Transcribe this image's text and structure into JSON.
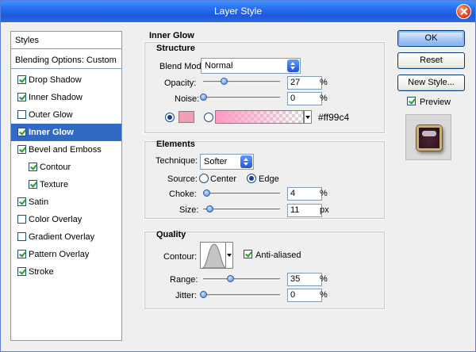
{
  "window": {
    "title": "Layer Style"
  },
  "styles_list": {
    "header": "Styles",
    "blending": "Blending Options: Custom",
    "items": [
      {
        "label": "Drop Shadow",
        "checked": true,
        "selected": false
      },
      {
        "label": "Inner Shadow",
        "checked": true,
        "selected": false
      },
      {
        "label": "Outer Glow",
        "checked": false,
        "selected": false
      },
      {
        "label": "Inner Glow",
        "checked": true,
        "selected": true
      },
      {
        "label": "Bevel and Emboss",
        "checked": true,
        "selected": false
      },
      {
        "label": "Contour",
        "checked": true,
        "selected": false
      },
      {
        "label": "Texture",
        "checked": true,
        "selected": false
      },
      {
        "label": "Satin",
        "checked": true,
        "selected": false
      },
      {
        "label": "Color Overlay",
        "checked": false,
        "selected": false
      },
      {
        "label": "Gradient Overlay",
        "checked": false,
        "selected": false
      },
      {
        "label": "Pattern Overlay",
        "checked": true,
        "selected": false
      },
      {
        "label": "Stroke",
        "checked": true,
        "selected": false
      }
    ]
  },
  "panel": {
    "title": "Inner Glow",
    "structure": {
      "title": "Structure",
      "blend_mode_label": "Blend Mode:",
      "blend_mode_value": "Normal",
      "opacity_label": "Opacity:",
      "opacity_value": "27",
      "opacity_unit": "%",
      "noise_label": "Noise:",
      "noise_value": "0",
      "noise_unit": "%",
      "color_hex": "#ff99c4",
      "swatch_color": "#f59db4",
      "gradient_color": "#ff99c4"
    },
    "elements": {
      "title": "Elements",
      "technique_label": "Technique:",
      "technique_value": "Softer",
      "source_label": "Source:",
      "source_center": "Center",
      "source_edge": "Edge",
      "choke_label": "Choke:",
      "choke_value": "4",
      "choke_unit": "%",
      "size_label": "Size:",
      "size_value": "11",
      "size_unit": "px"
    },
    "quality": {
      "title": "Quality",
      "contour_label": "Contour:",
      "antialiased_label": "Anti-aliased",
      "antialiased_checked": true,
      "range_label": "Range:",
      "range_value": "35",
      "range_unit": "%",
      "jitter_label": "Jitter:",
      "jitter_value": "0",
      "jitter_unit": "%"
    }
  },
  "buttons": {
    "ok": "OK",
    "reset": "Reset",
    "new_style": "New Style...",
    "preview_label": "Preview",
    "preview_checked": true
  }
}
